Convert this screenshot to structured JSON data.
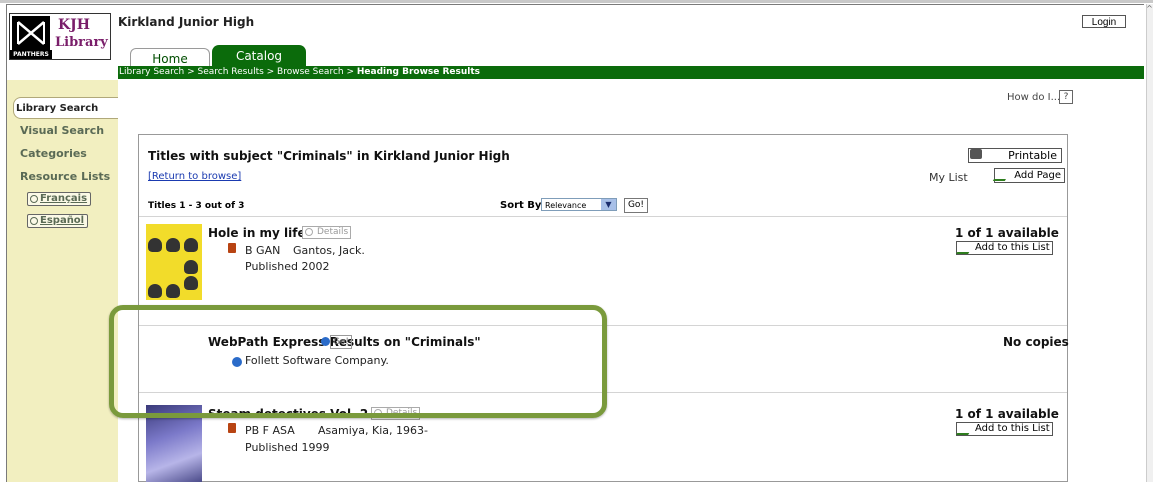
{
  "header": {
    "logo_kjh": "KJH",
    "logo_library": "Library",
    "logo_panthers": "PANTHERS",
    "school_title": "Kirkland Junior High",
    "login_label": "Login"
  },
  "tabs": [
    {
      "label": "Home",
      "active": false
    },
    {
      "label": "Catalog",
      "active": true
    }
  ],
  "breadcrumb": {
    "trail": "Library Search > Search Results > Browse Search > ",
    "current": "Heading Browse Results"
  },
  "sidebar": {
    "items": [
      {
        "label": "Library Search",
        "active": true
      },
      {
        "label": "Visual Search"
      },
      {
        "label": "Categories"
      },
      {
        "label": "Resource Lists"
      }
    ],
    "languages": [
      "Français",
      "Español"
    ]
  },
  "help": {
    "text": "How do I...",
    "button": "?"
  },
  "results": {
    "title": "Titles with subject \"Criminals\" in Kirkland Junior High",
    "return_link": "[Return to browse]",
    "printable_label": "Printable",
    "mylist_label": "My List",
    "addpage_label": "Add Page",
    "count_label": "Titles 1 - 3 out of 3",
    "sort_label": "Sort By",
    "sort_value": "Relevance",
    "go_label": "Go!",
    "rows": [
      {
        "title": "Hole in my life",
        "details_label": "Details",
        "call_number": "B GAN",
        "author": "Gantos, Jack.",
        "published": "Published 2002",
        "availability": "1 of 1 available",
        "add_label": "Add to this List"
      },
      {
        "title": "WebPath Express Results on \"Criminals\"",
        "go_label": "Go!",
        "publisher": "Follett Software Company.",
        "availability": "No copies"
      },
      {
        "title": "Steam detectives Vol. 2",
        "details_label": "Details",
        "call_number": "PB F ASA",
        "author": "Asamiya, Kia, 1963-",
        "published": "Published 1999",
        "availability": "1 of 1 available",
        "add_label": "Add to this List"
      }
    ]
  },
  "colors": {
    "brand_green": "#0b6b0b",
    "sidebar_bg": "#f2efc0",
    "highlight": "#7a9a3c",
    "link": "#1a3ab0"
  }
}
